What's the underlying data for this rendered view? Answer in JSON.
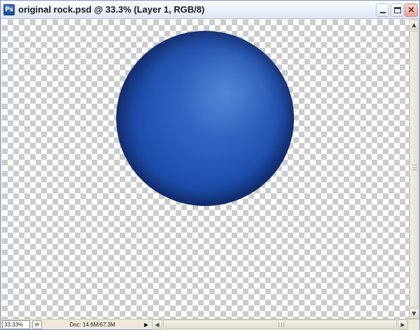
{
  "window": {
    "title": "original rock.psd @ 33.3% (Layer 1, RGB/8)",
    "app_icon": "Ps",
    "controls": {
      "minimize": "minimize-icon",
      "maximize": "maximize-icon",
      "close": "×"
    }
  },
  "canvas": {
    "background": "transparency-checkerboard",
    "layer_content": "blue-sphere",
    "colors": {
      "sphere": "#2e63c4",
      "sphere_shadow": "#0f2a63"
    }
  },
  "statusbar": {
    "zoom": "33.33%",
    "doc_info": "Doc: 14.6M/67.3M",
    "menu_arrow": "▶"
  },
  "scrollbars": {
    "up": "▲",
    "down": "▼",
    "left": "◀",
    "right": "▶"
  }
}
